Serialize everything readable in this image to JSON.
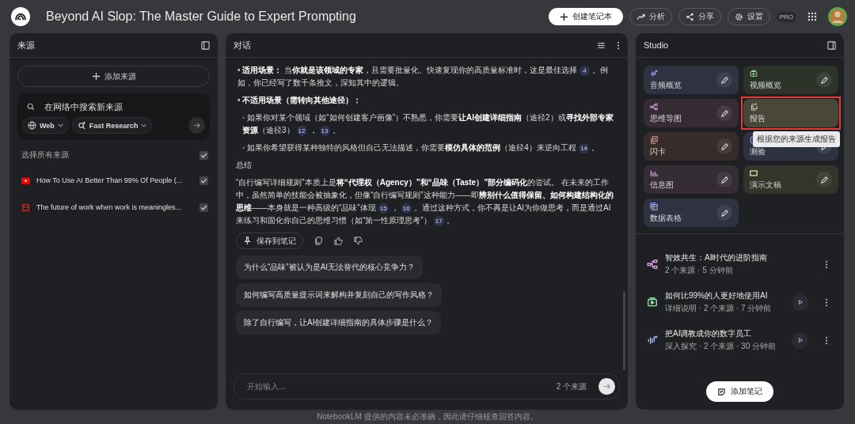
{
  "header": {
    "title": "Beyond AI Slop: The Master Guide to Expert Prompting",
    "create_button": "创建笔记本",
    "actions": [
      {
        "kind": "chart",
        "label": "分析"
      },
      {
        "kind": "share",
        "label": "分享"
      },
      {
        "kind": "gear",
        "label": "设置"
      }
    ],
    "plan_badge": "PRO"
  },
  "sources": {
    "title": "来源",
    "add_button": "添加来源",
    "search": {
      "placeholder": "在网络中搜索新来源",
      "chips": [
        {
          "kind": "web",
          "label": "Web"
        },
        {
          "kind": "research",
          "label": "Fast Research"
        }
      ]
    },
    "select_all": {
      "label": "选择所有来源",
      "checked": true
    },
    "items": [
      {
        "kind": "youtube",
        "title": "How To Use AI Better Than 99% Of People (...",
        "checked": true
      },
      {
        "kind": "pdf",
        "title": "The future of work when work is meaningles...",
        "checked": true
      }
    ]
  },
  "chat": {
    "title": "对话",
    "paragraphs": [
      {
        "kind": "bullet",
        "segments": [
          {
            "kind": "text",
            "text": "• **适用场景：** 当**你就是该领域的专家**，且需要批量化、快速复现你的高质量标准时，这是最佳选择"
          },
          {
            "kind": "cite",
            "text": "4"
          },
          {
            "kind": "text",
            "text": "。例如，你已经写了数千条推文，深知其中的逻辑。"
          }
        ]
      },
      {
        "kind": "bullet",
        "segments": [
          {
            "kind": "text",
            "text": "• **不适用场景（需转向其他途径）：**"
          }
        ]
      },
      {
        "kind": "sub",
        "segments": [
          {
            "kind": "text",
            "text": "◦ 如果你对某个领域（如“如何创建客户画像”）不熟悉，你需要**让AI创建详细指南**（途径2）或**寻找外部专家资源**（途径3）"
          },
          {
            "kind": "cite",
            "text": "12"
          },
          {
            "kind": "text",
            "text": "，"
          },
          {
            "kind": "cite",
            "text": "13"
          },
          {
            "kind": "text",
            "text": "。"
          }
        ]
      },
      {
        "kind": "sub",
        "segments": [
          {
            "kind": "text",
            "text": "◦ 如果你希望获得某种独特的风格但自己无法描述，你需要**模仿具体的范例**（途径4）来逆向工程"
          },
          {
            "kind": "cite",
            "text": "14"
          },
          {
            "kind": "text",
            "text": "。"
          }
        ]
      },
      {
        "kind": "plain",
        "segments": [
          {
            "kind": "text",
            "text": "总结"
          }
        ]
      },
      {
        "kind": "plain",
        "segments": [
          {
            "kind": "text",
            "text": "“自行编写详细规则”本质上是**将“代理权（Agency）”和“品味（Taste）”部分编码化**的尝试。 在未来的工作中，虽然简单的技能会被抽象化，但像“自行编写规则”这种能力——即**辨别什么值得保留、如何构建结构化的思维**——本身就是一种高级的“品味”体现"
          },
          {
            "kind": "cite",
            "text": "15"
          },
          {
            "kind": "text",
            "text": "，"
          },
          {
            "kind": "cite",
            "text": "16"
          },
          {
            "kind": "text",
            "text": "。通过这种方式，你不再是让AI为你做思考，而是通过AI来练习和固化你自己的思维习惯（如“第一性原理思考”）"
          },
          {
            "kind": "cite",
            "text": "17"
          },
          {
            "kind": "text",
            "text": "。"
          }
        ]
      }
    ],
    "save_button": "保存到笔记",
    "suggestions": [
      "为什么“品味”被认为是AI无法替代的核心竞争力？",
      "如何编写高质量提示词来解构并复刻自己的写作风格？",
      "除了自行编写，让AI创建详细指南的具体步骤是什么？"
    ],
    "input": {
      "placeholder": "开始输入...",
      "source_count": "2 个来源"
    }
  },
  "studio": {
    "title": "Studio",
    "tiles": [
      {
        "kind": "audio",
        "label": "音频概览",
        "color": "#2f3240",
        "highlighted": false
      },
      {
        "kind": "video",
        "label": "视频概览",
        "color": "#2d3329",
        "highlighted": false
      },
      {
        "kind": "mindmap",
        "label": "思维导图",
        "color": "#372c34",
        "highlighted": false
      },
      {
        "kind": "report",
        "label": "报告",
        "color": "#48473a",
        "highlighted": true
      },
      {
        "kind": "flashcard",
        "label": "闪卡",
        "color": "#362d2b",
        "highlighted": false
      },
      {
        "kind": "quiz",
        "label": "测验",
        "color": "#2e3240",
        "highlighted": false
      },
      {
        "kind": "infographic",
        "label": "信息图",
        "color": "#362c34",
        "highlighted": false
      },
      {
        "kind": "slides",
        "label": "演示文稿",
        "color": "#33342a",
        "highlighted": false
      },
      {
        "kind": "table",
        "label": "数据表格",
        "color": "#2f3240",
        "highlighted": false
      }
    ],
    "tooltip": "根据您的来源生成报告",
    "notes": [
      {
        "kind": "mindmap",
        "title": "智效共生：AI时代的进阶指南",
        "meta": "2 个来源 · 5 分钟前"
      },
      {
        "kind": "video",
        "title": "如何比99%的人更好地使用AI",
        "meta": "详细说明 · 2 个来源 · 7 分钟前"
      },
      {
        "kind": "audio",
        "title": "把AI调教成你的数字员工",
        "meta": "深入探究 · 2 个来源 · 30 分钟前"
      }
    ],
    "add_note_button": "添加笔记"
  },
  "footer": "NotebookLM 提供的内容未必准确，因此请仔细核查回答内容。"
}
